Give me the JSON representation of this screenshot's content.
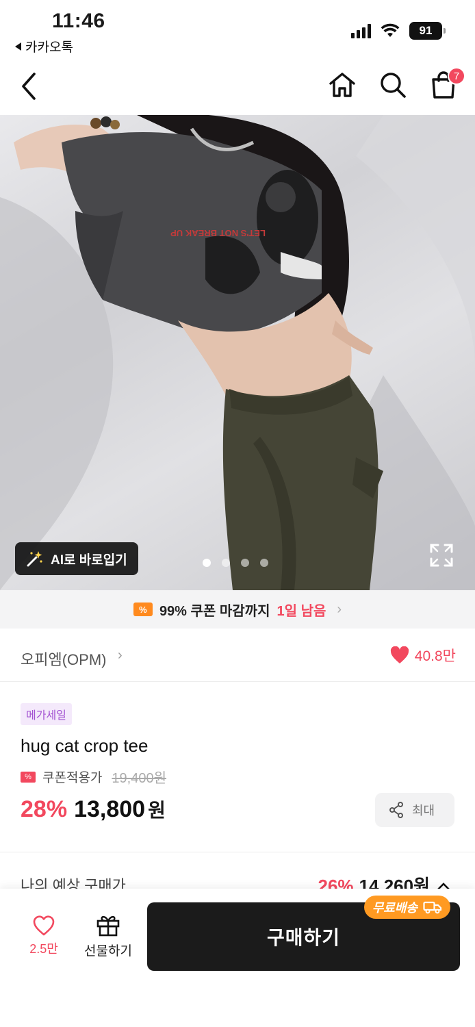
{
  "status_bar": {
    "time": "11:46",
    "back_app": "카카오톡",
    "battery": "91"
  },
  "nav": {
    "cart_count": "7",
    "icons": [
      "back-chevron-icon",
      "home-icon",
      "search-icon",
      "shopping-bag-icon"
    ]
  },
  "hero": {
    "ai_button_label": "AI로 바로입기",
    "pagination": {
      "total": 4,
      "current": 1
    },
    "shirt_print_text": "LET'S NOT BREAK UP"
  },
  "coupon_banner": {
    "text": "99% 쿠폰 마감까지",
    "highlight": "1일 남음"
  },
  "brand": {
    "name": "오피엠(OPM)",
    "likes": "40.8만"
  },
  "product": {
    "badge": "메가세일",
    "title": "hug cat crop tee",
    "coupon_label": "쿠폰적용가",
    "original_price": "19,400원",
    "discount": "28%",
    "price": "13,800",
    "currency": "원",
    "share_label": "최대"
  },
  "estimated": {
    "label": "나의 예상 구매가",
    "discount": "26%",
    "price": "14,260원"
  },
  "bottom_bar": {
    "wish_count": "2.5만",
    "gift_label": "선물하기",
    "buy_label": "구매하기",
    "free_shipping": "무료배송"
  },
  "colors": {
    "accent_red": "#f2485e",
    "orange": "#ff9a22",
    "dark_button": "#1b1b1b",
    "mega_badge_bg": "#f4e9fb",
    "mega_badge_text": "#a352d2"
  }
}
